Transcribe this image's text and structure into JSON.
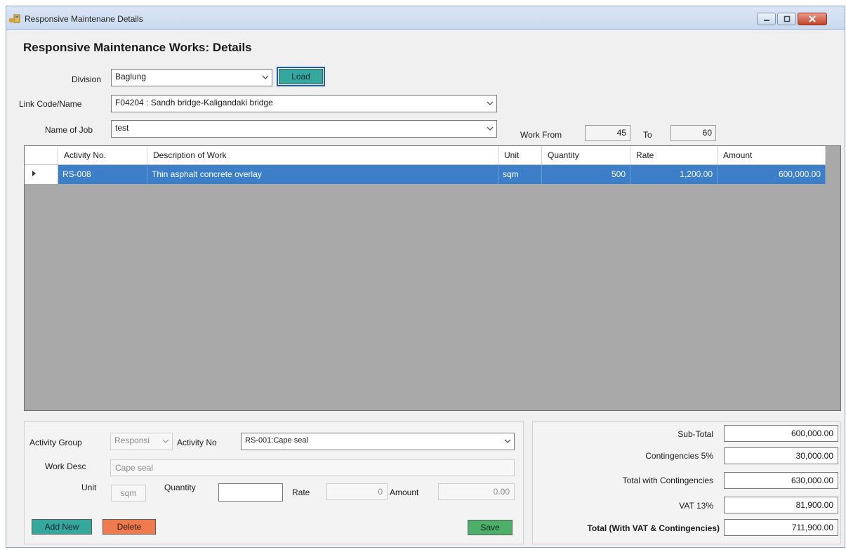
{
  "window": {
    "title": "Responsive Maintenane Details"
  },
  "heading": "Responsive Maintenance Works: Details",
  "filters": {
    "division_label": "Division",
    "division_value": "Baglung",
    "load_label": "Load",
    "link_label": "Link Code/Name",
    "link_value": "F04204 : Sandh bridge-Kaligandaki bridge",
    "job_label": "Name of Job",
    "job_value": "test",
    "work_from_label": "Work From",
    "work_from_value": "45",
    "to_label": "To",
    "to_value": "60"
  },
  "grid": {
    "columns": [
      "Activity No.",
      "Description of Work",
      "Unit",
      "Quantity",
      "Rate",
      "Amount"
    ],
    "rows": [
      {
        "activity_no": "RS-008",
        "description": "Thin asphalt concrete overlay",
        "unit": "sqm",
        "quantity": "500",
        "rate": "1,200.00",
        "amount": "600,000.00"
      }
    ]
  },
  "entry": {
    "activity_group_label": "Activity Group",
    "activity_group_value": "Responsi",
    "activity_no_label": "Activity No",
    "activity_no_value": "RS-001:Cape seal",
    "work_desc_label": "Work Desc",
    "work_desc_value": "Cape seal",
    "unit_label": "Unit",
    "unit_value": "sqm",
    "quantity_label": "Quantity",
    "quantity_value": "",
    "rate_label": "Rate",
    "rate_value": "0",
    "amount_label": "Amount",
    "amount_value": "0.00",
    "add_new_label": "Add New",
    "delete_label": "Delete",
    "save_label": "Save"
  },
  "totals": {
    "subtotal_label": "Sub-Total",
    "subtotal_value": "600,000.00",
    "contingencies_label": "Contingencies 5%",
    "contingencies_value": "30,000.00",
    "with_cont_label": "Total with Contingencies",
    "with_cont_value": "630,000.00",
    "vat_label": "VAT 13%",
    "vat_value": "81,900.00",
    "grand_label": "Total (With VAT & Contingencies)",
    "grand_value": "711,900.00"
  },
  "colors": {
    "selection": "#3c7fc8",
    "grid_background": "#a9a9a9",
    "button_teal": "#35a89e",
    "button_orange": "#ee7a4d",
    "button_green": "#4caf6a"
  },
  "icons": [
    "app-icon",
    "minimize-icon",
    "maximize-icon",
    "close-icon",
    "chevron-down-icon",
    "row-pointer-icon"
  ]
}
